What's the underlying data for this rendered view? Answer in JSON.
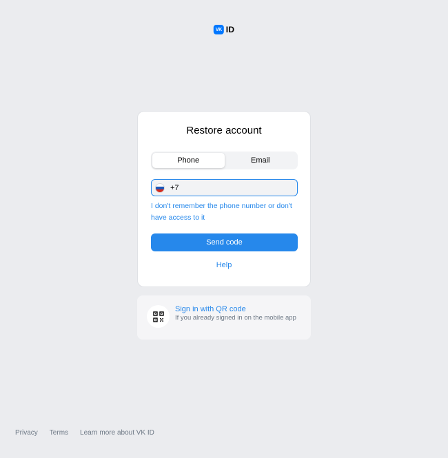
{
  "logo": {
    "mark": "VK",
    "text": "ID"
  },
  "card": {
    "title": "Restore account",
    "tabs": [
      {
        "label": "Phone",
        "active": true
      },
      {
        "label": "Email",
        "active": false
      }
    ],
    "phone_input": {
      "value": "+7",
      "country_flag": "russia-flag-icon"
    },
    "forgot_link": "I don't remember the phone number or don't have access to it",
    "send_button": "Send code",
    "help_link": "Help"
  },
  "qr": {
    "icon": "qr-code-icon",
    "title": "Sign in with QR code",
    "subtitle": "If you already signed in on the mobile app"
  },
  "footer": {
    "links": [
      "Privacy",
      "Terms",
      "Learn more about VK ID"
    ]
  },
  "colors": {
    "accent": "#2688eb",
    "background": "#ebecef",
    "logo_blue": "#0077ff",
    "muted_text": "#6d7885"
  }
}
